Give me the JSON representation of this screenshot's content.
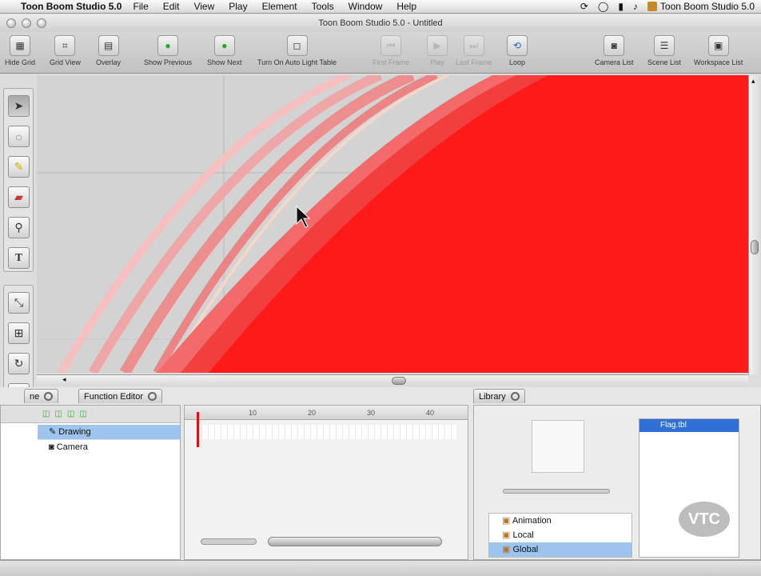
{
  "menubar": {
    "app_name": "Toon Boom Studio 5.0",
    "items": [
      "File",
      "Edit",
      "View",
      "Play",
      "Element",
      "Tools",
      "Window",
      "Help"
    ],
    "right_app": "Toon Boom Studio 5.0"
  },
  "window": {
    "title": "Toon Boom Studio 5.0 - Untitled"
  },
  "toolbar": {
    "hide_grid": "Hide Grid",
    "grid_view": "Grid View",
    "overlay": "Overlay",
    "show_previous": "Show Previous",
    "show_next": "Show Next",
    "light_table": "Turn On Auto Light Table",
    "first_frame": "First Frame",
    "play": "Play",
    "last_frame": "Last Frame",
    "loop": "Loop",
    "camera_list": "Camera List",
    "scene_list": "Scene List",
    "workspace_list": "Workspace List"
  },
  "panels": {
    "timeline_tab": "ne",
    "function_editor_tab": "Function Editor",
    "library_tab": "Library",
    "layers": [
      "Drawing",
      "Camera"
    ],
    "frame_numbers": [
      "10",
      "20",
      "30",
      "40"
    ],
    "library_tree": [
      "Animation",
      "Local",
      "Global"
    ],
    "library_selected_item": "Flag.tbl"
  },
  "watermark": "VTC",
  "colors": {
    "drawing_fill": "#ff1a1a",
    "canvas_bg": "#d3d3d3",
    "selection": "#9cc4ec"
  },
  "icons": {
    "apple": "",
    "volume": "speaker-icon",
    "battery": "battery-icon"
  }
}
